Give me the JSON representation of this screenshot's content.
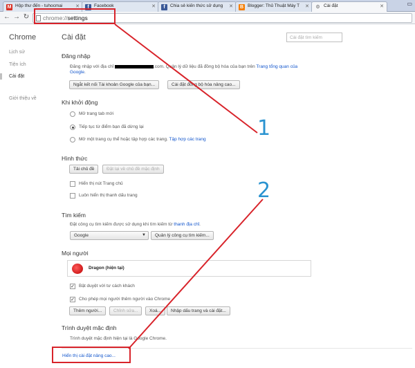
{
  "tabs": [
    {
      "label": "Hộp thư đến - tuhocmai",
      "icon": "gmail-icon",
      "color": "#d93025"
    },
    {
      "label": "Facebook",
      "icon": "facebook-icon",
      "color": "#3b5998"
    },
    {
      "label": "Chia sẻ kiến thức sử dụng",
      "icon": "facebook-icon",
      "color": "#3b5998"
    },
    {
      "label": "Blogger: Thủ Thuật Máy T",
      "icon": "blogger-icon",
      "color": "#f57d00"
    },
    {
      "label": "Cài đặt",
      "icon": "gear-icon",
      "color": "#666666"
    }
  ],
  "toolbar": {
    "url_scheme": "chrome://",
    "url_path": "settings"
  },
  "sidebar": {
    "title": "Chrome",
    "items": [
      {
        "label": "Lịch sử"
      },
      {
        "label": "Tiện ích"
      },
      {
        "label": "Cài đặt"
      },
      {
        "label": "Giới thiệu về"
      }
    ]
  },
  "main": {
    "title": "Cài đặt",
    "search_placeholder": "Cài đặt tìm kiếm",
    "signin": {
      "heading": "Đăng nhập",
      "text_before": "Đăng nhập với địa chỉ",
      "text_after": ".com. Quản lý dữ liệu đã đồng bộ hóa của bạn trên",
      "link1": "Trang tổng quan của",
      "link2": "Google",
      "text_end": ".",
      "disconnect_button": "Ngắt kết nối Tài khoản Google của bạn...",
      "advanced_sync_button": "Cài đặt đồng bộ hóa nâng cao..."
    },
    "startup": {
      "heading": "Khi khởi động",
      "options": [
        "Mở trang tab mới",
        "Tiếp tục từ điểm bạn đã dừng lại",
        "Mở một trang cụ thể hoặc tập hợp các trang."
      ],
      "set_pages_link": "Tập hợp các trang",
      "selected_index": 1
    },
    "appearance": {
      "heading": "Hình thức",
      "get_themes_button": "Tải chủ đề",
      "reset_theme_button": "Đặt lại về chủ đề mặc định",
      "show_home": "Hiển thị nút Trang chủ",
      "show_bookmarks": "Luôn hiển thị thanh dấu trang"
    },
    "search": {
      "heading": "Tìm kiếm",
      "text": "Đặt công cụ tìm kiếm được sử dụng khi tìm kiếm từ",
      "link": "thanh địa chỉ",
      "text_end": ".",
      "engine": "Google",
      "manage_button": "Quản lý công cụ tìm kiếm..."
    },
    "people": {
      "heading": "Mọi người",
      "profile_name": "Dragon (hiện tại)",
      "guest_browsing": "Bật duyệt với tư cách khách",
      "let_anyone_add": "Cho phép mọi người thêm người vào Chrome",
      "add_button": "Thêm người...",
      "edit_button": "Chỉnh sửa...",
      "remove_button": "Xoá...",
      "import_button": "Nhập dấu trang và cài đặt..."
    },
    "default_browser": {
      "heading": "Trình duyệt mặc định",
      "text": "Trình duyệt mặc định hiện tại là Google Chrome."
    },
    "advanced_link": "Hiển thị cài đặt nâng cao..."
  },
  "annotations": {
    "label1": "1",
    "label2": "2",
    "box_color": "#d8232a",
    "number_color": "#2a93d0"
  }
}
